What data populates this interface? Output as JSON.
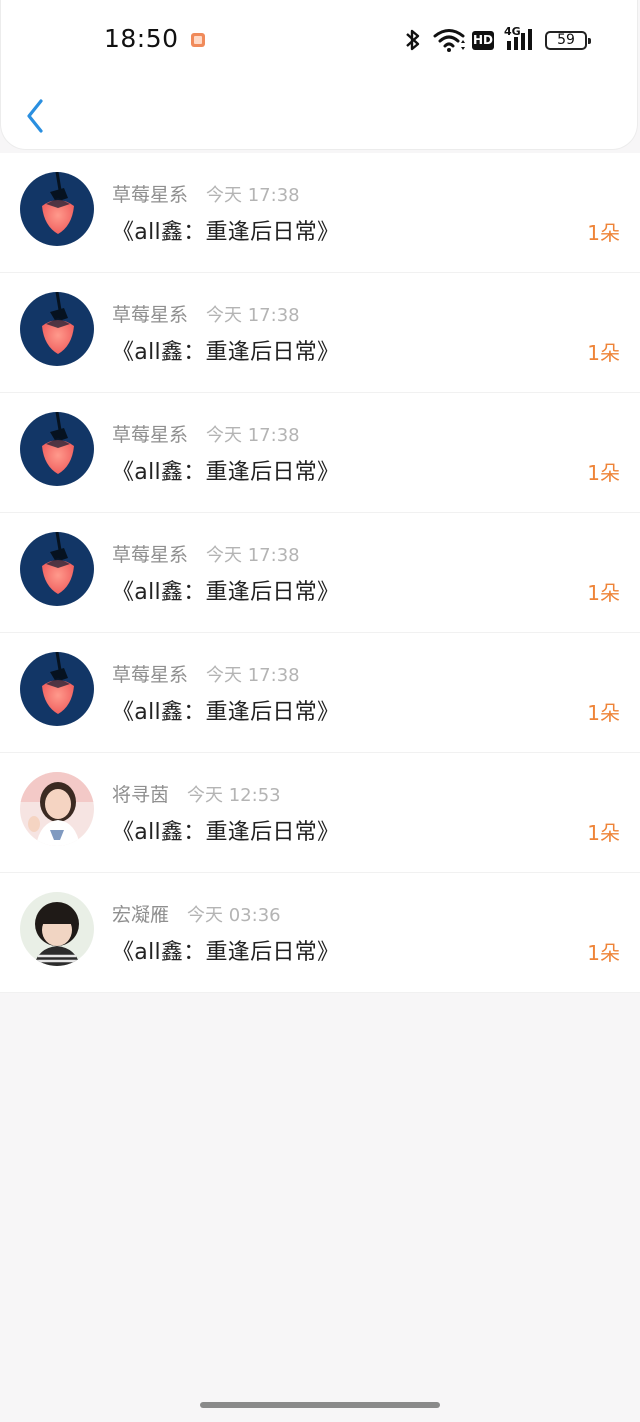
{
  "status_bar": {
    "time": "18:50",
    "hd": "HD",
    "network": "4G",
    "battery": "59"
  },
  "rows": [
    {
      "name": "草莓星系",
      "time": "今天 17:38",
      "title": "《all鑫：重逢后日常》",
      "count": "1朵",
      "avatar": "strawberry-avatar"
    },
    {
      "name": "草莓星系",
      "time": "今天 17:38",
      "title": "《all鑫：重逢后日常》",
      "count": "1朵",
      "avatar": "strawberry-avatar"
    },
    {
      "name": "草莓星系",
      "time": "今天 17:38",
      "title": "《all鑫：重逢后日常》",
      "count": "1朵",
      "avatar": "strawberry-avatar"
    },
    {
      "name": "草莓星系",
      "time": "今天 17:38",
      "title": "《all鑫：重逢后日常》",
      "count": "1朵",
      "avatar": "strawberry-avatar"
    },
    {
      "name": "草莓星系",
      "time": "今天 17:38",
      "title": "《all鑫：重逢后日常》",
      "count": "1朵",
      "avatar": "strawberry-avatar"
    },
    {
      "name": "将寻茵",
      "time": "今天 12:53",
      "title": "《all鑫：重逢后日常》",
      "count": "1朵",
      "avatar": "girl-avatar"
    },
    {
      "name": "宏凝雁",
      "time": "今天 03:36",
      "title": "《all鑫：重逢后日常》",
      "count": "1朵",
      "avatar": "child-avatar"
    }
  ],
  "colors": {
    "accent": "#ee8438",
    "back": "#2a8fe0"
  }
}
